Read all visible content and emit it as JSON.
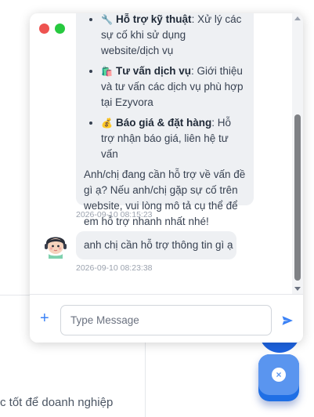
{
  "background": {
    "partial_text": "c tốt để doanh nghiệp"
  },
  "chat": {
    "bot_message": {
      "items": [
        {
          "icon": "wrench-icon",
          "emoji": "🔧",
          "title": "Hỗ trợ kỹ thuật",
          "text": ": Xử lý các sự cố khi sử dụng website/dịch vụ"
        },
        {
          "icon": "shopping-bag-icon",
          "emoji": "🛍️",
          "title": "Tư vấn dịch vụ",
          "text": ": Giới thiệu và tư vấn các dịch vụ phù hợp tại Ezyvora"
        },
        {
          "icon": "money-bag-icon",
          "emoji": "💰",
          "title": "Báo giá & đặt hàng",
          "text": ": Hỗ trợ nhận báo giá, liên hệ tư vấn"
        }
      ],
      "closing": "Anh/chị đang cần hỗ trợ về vấn đề gì ạ? Nếu anh/chị gặp sự cố trên website, vui lòng mô tả cụ thể để em hỗ trợ nhanh nhất nhé!",
      "timestamp": "2026-09-10 08:15:23"
    },
    "user_message": {
      "text": "anh chị cần hỗ trợ thông tin gì ạ",
      "timestamp": "2026-09-10 08:23:38",
      "avatar_icon": "support-agent-avatar"
    },
    "input": {
      "placeholder": "Type Message",
      "value": ""
    },
    "colors": {
      "accent": "#3b82f6",
      "bubble": "#eef0f3",
      "window_close": "#ee5350",
      "window_expand": "#27c93f",
      "fab": "#1f6fe5"
    }
  }
}
